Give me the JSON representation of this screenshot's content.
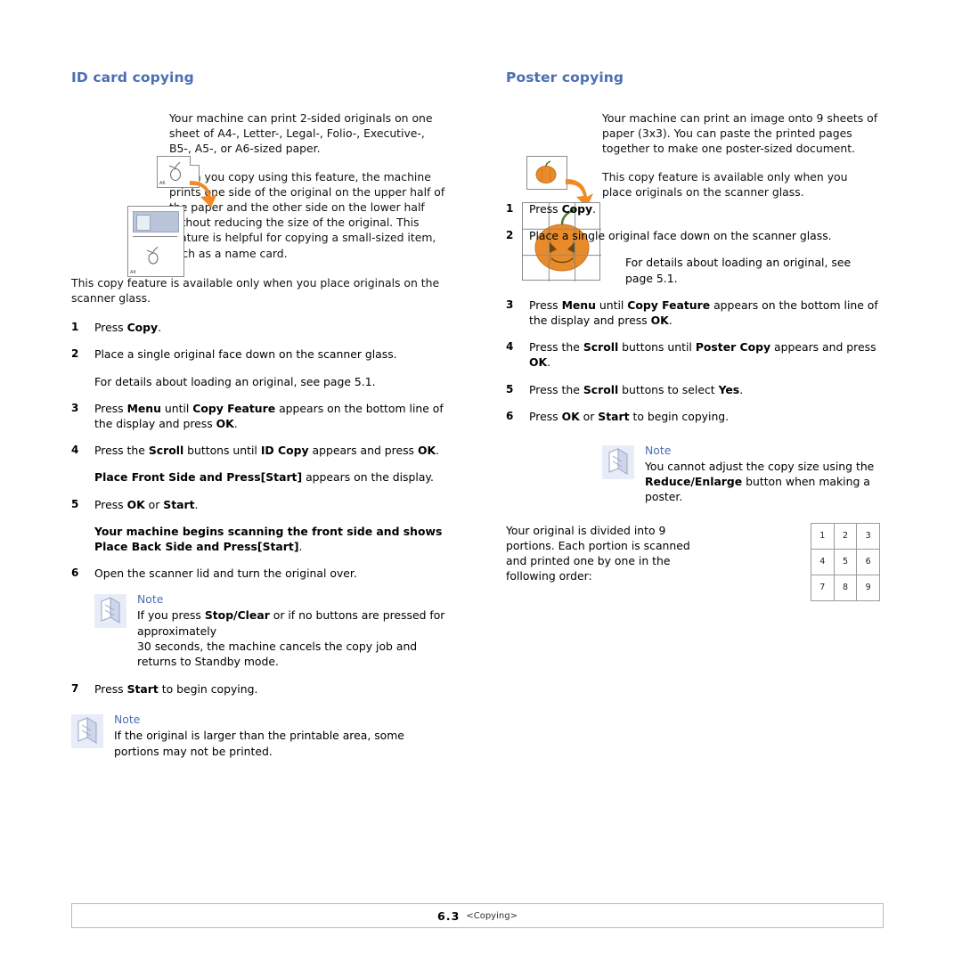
{
  "footer": {
    "page_number": "6.3",
    "chapter": "<Copying>"
  },
  "left_column": {
    "title": "ID card copying",
    "paragraphs": [
      "Your machine can print 2-sided originals on one sheet of A4-, Letter-, Legal-, Folio-, Executive-, B5-, A5-, or A6-sized paper.",
      "When you copy using this feature, the machine prints one side of the original on the upper half of the paper and the other side on the lower half without reducing the size of the original. This feature is helpful for copying a small-sized item, such as a name card.",
      "This copy feature is available only when you place originals on the scanner glass."
    ],
    "steps": [
      {
        "num": "1",
        "text_html": "Press <b>Copy</b>."
      },
      {
        "num": "2",
        "text_html": "Place a single original face down on the scanner glass."
      },
      {
        "num": "",
        "text_html": "For details about loading an original, see page 5.1.",
        "sub": true
      },
      {
        "num": "3",
        "text_html": "Press <b>Menu</b> until <b>Copy Feature</b> appears on the bottom line of the display and press <b>OK</b>."
      },
      {
        "num": "4",
        "text_html": "Press the <b>Scroll</b> buttons until <b>ID Copy</b> appears and press <b>OK</b>."
      },
      {
        "num": "",
        "text_html": "<b>Place Front Side and Press[Start]</b> appears on the display.",
        "sub": true
      },
      {
        "num": "5",
        "text_html": "Press <b>OK</b> or <b>Start</b>."
      },
      {
        "num": "",
        "text_html": "<b>Your machine begins scanning the front side and shows Place Back Side and Press[Start]</b>.",
        "sub": true
      },
      {
        "num": "6",
        "text_html": "Open the scanner lid and turn the original over."
      }
    ],
    "note_1": {
      "title": "Note",
      "body_html": "If you press <b>Stop/Clear</b> or if no buttons are pressed for approximately<br>30 seconds, the machine cancels the copy job and returns to Standby mode."
    },
    "step_7": {
      "num": "7",
      "text_html": "Press <b>Start</b> to begin copying."
    },
    "note_2": {
      "title": "Note",
      "body_html": "If the original is larger than the printable area, some portions may not be printed."
    },
    "artwork": {
      "small_sheet_label": "A6",
      "large_sheet_label": "A4"
    }
  },
  "right_column": {
    "title": "Poster copying",
    "paragraphs": [
      "Your machine can print an image onto 9 sheets of paper (3x3). You can paste the printed pages together to make one poster-sized document.",
      "This copy feature is available only when you place originals on the scanner glass."
    ],
    "steps": [
      {
        "num": "1",
        "text_html": "Press <b>Copy</b>."
      },
      {
        "num": "2",
        "text_html": "Place a single original face down on the scanner glass."
      },
      {
        "num": "",
        "text_html": "For details about loading an original, see page 5.1.",
        "sub": true
      },
      {
        "num": "3",
        "text_html": "Press <b>Menu</b> until <b>Copy Feature</b> appears on the bottom line of the display and press <b>OK</b>."
      },
      {
        "num": "4",
        "text_html": "Press the <b>Scroll</b> buttons until <b>Poster Copy</b> appears and press <b>OK</b>."
      },
      {
        "num": "5",
        "text_html": "Press the <b>Scroll</b> buttons to select <b>Yes</b>."
      },
      {
        "num": "6",
        "text_html": "Press <b>OK</b> or <b>Start</b> to begin copying."
      }
    ],
    "note": {
      "title": "Note",
      "body_html": "You cannot adjust the copy size using the <b>Reduce/Enlarge</b> button when making a poster."
    },
    "order_text": "Your original is divided into 9 portions. Each portion is scanned and printed one by one in the following order:",
    "order_grid": [
      [
        "1",
        "2",
        "3"
      ],
      [
        "4",
        "5",
        "6"
      ],
      [
        "7",
        "8",
        "9"
      ]
    ]
  },
  "colors": {
    "heading_blue": "#4a6fb5",
    "note_blue": "#4a6fb5",
    "note_icon_bg": "#e8ecf7",
    "arrow_orange": "#f08a24",
    "pumpkin_orange": "#e98b2a"
  }
}
